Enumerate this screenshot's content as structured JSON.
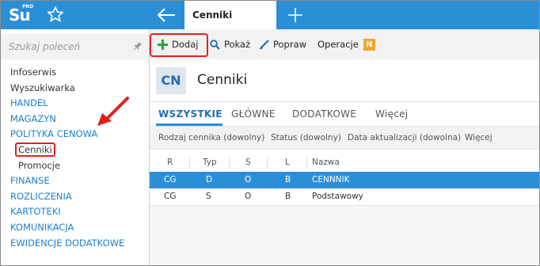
{
  "app": {
    "logo_text": "Su",
    "logo_sup": "PRO",
    "active_tab": "Cenniki"
  },
  "sidebar": {
    "search_placeholder": "Szukaj poleceń",
    "items": [
      {
        "label": "Infoserwis",
        "kind": "plain"
      },
      {
        "label": "Wyszukiwarka",
        "kind": "plain"
      },
      {
        "label": "HANDEL",
        "kind": "section"
      },
      {
        "label": "MAGAZYN",
        "kind": "section"
      },
      {
        "label": "POLITYKA CENOWA",
        "kind": "section"
      },
      {
        "label": "Cenniki",
        "kind": "sub",
        "highlighted": true
      },
      {
        "label": "Promocje",
        "kind": "sub"
      },
      {
        "label": "FINANSE",
        "kind": "section"
      },
      {
        "label": "ROZLICZENIA",
        "kind": "section"
      },
      {
        "label": "KARTOTEKI",
        "kind": "section"
      },
      {
        "label": "KOMUNIKACJA",
        "kind": "section"
      },
      {
        "label": "EWIDENCJE DODATKOWE",
        "kind": "section"
      }
    ]
  },
  "toolbar": {
    "add_label": "Dodaj",
    "show_label": "Pokaż",
    "edit_label": "Popraw",
    "operations_label": "Operacje",
    "operations_badge": "N"
  },
  "page": {
    "badge": "CN",
    "title": "Cenniki"
  },
  "tabs": [
    "WSZYSTKIE",
    "GŁÓWNE",
    "DODATKOWE",
    "Więcej"
  ],
  "filters": [
    "Rodzaj cennika (dowolny)",
    "Status (dowolny)",
    "Data aktualizacji (dowolna)",
    "Więcej"
  ],
  "grid": {
    "columns": [
      "R",
      "Typ",
      "S",
      "L",
      "Nazwa"
    ],
    "rows": [
      {
        "r": "CG",
        "typ": "D",
        "s": "O",
        "l": "B",
        "nazwa": "CENNNIK",
        "selected": true
      },
      {
        "r": "CG",
        "typ": "S",
        "s": "O",
        "l": "B",
        "nazwa": "Podstawowy",
        "selected": false
      }
    ]
  },
  "colors": {
    "accent": "#2b8fd8",
    "annotation_red": "#e02020",
    "badge_orange": "#f3a530",
    "add_green": "#2e9e3e"
  }
}
